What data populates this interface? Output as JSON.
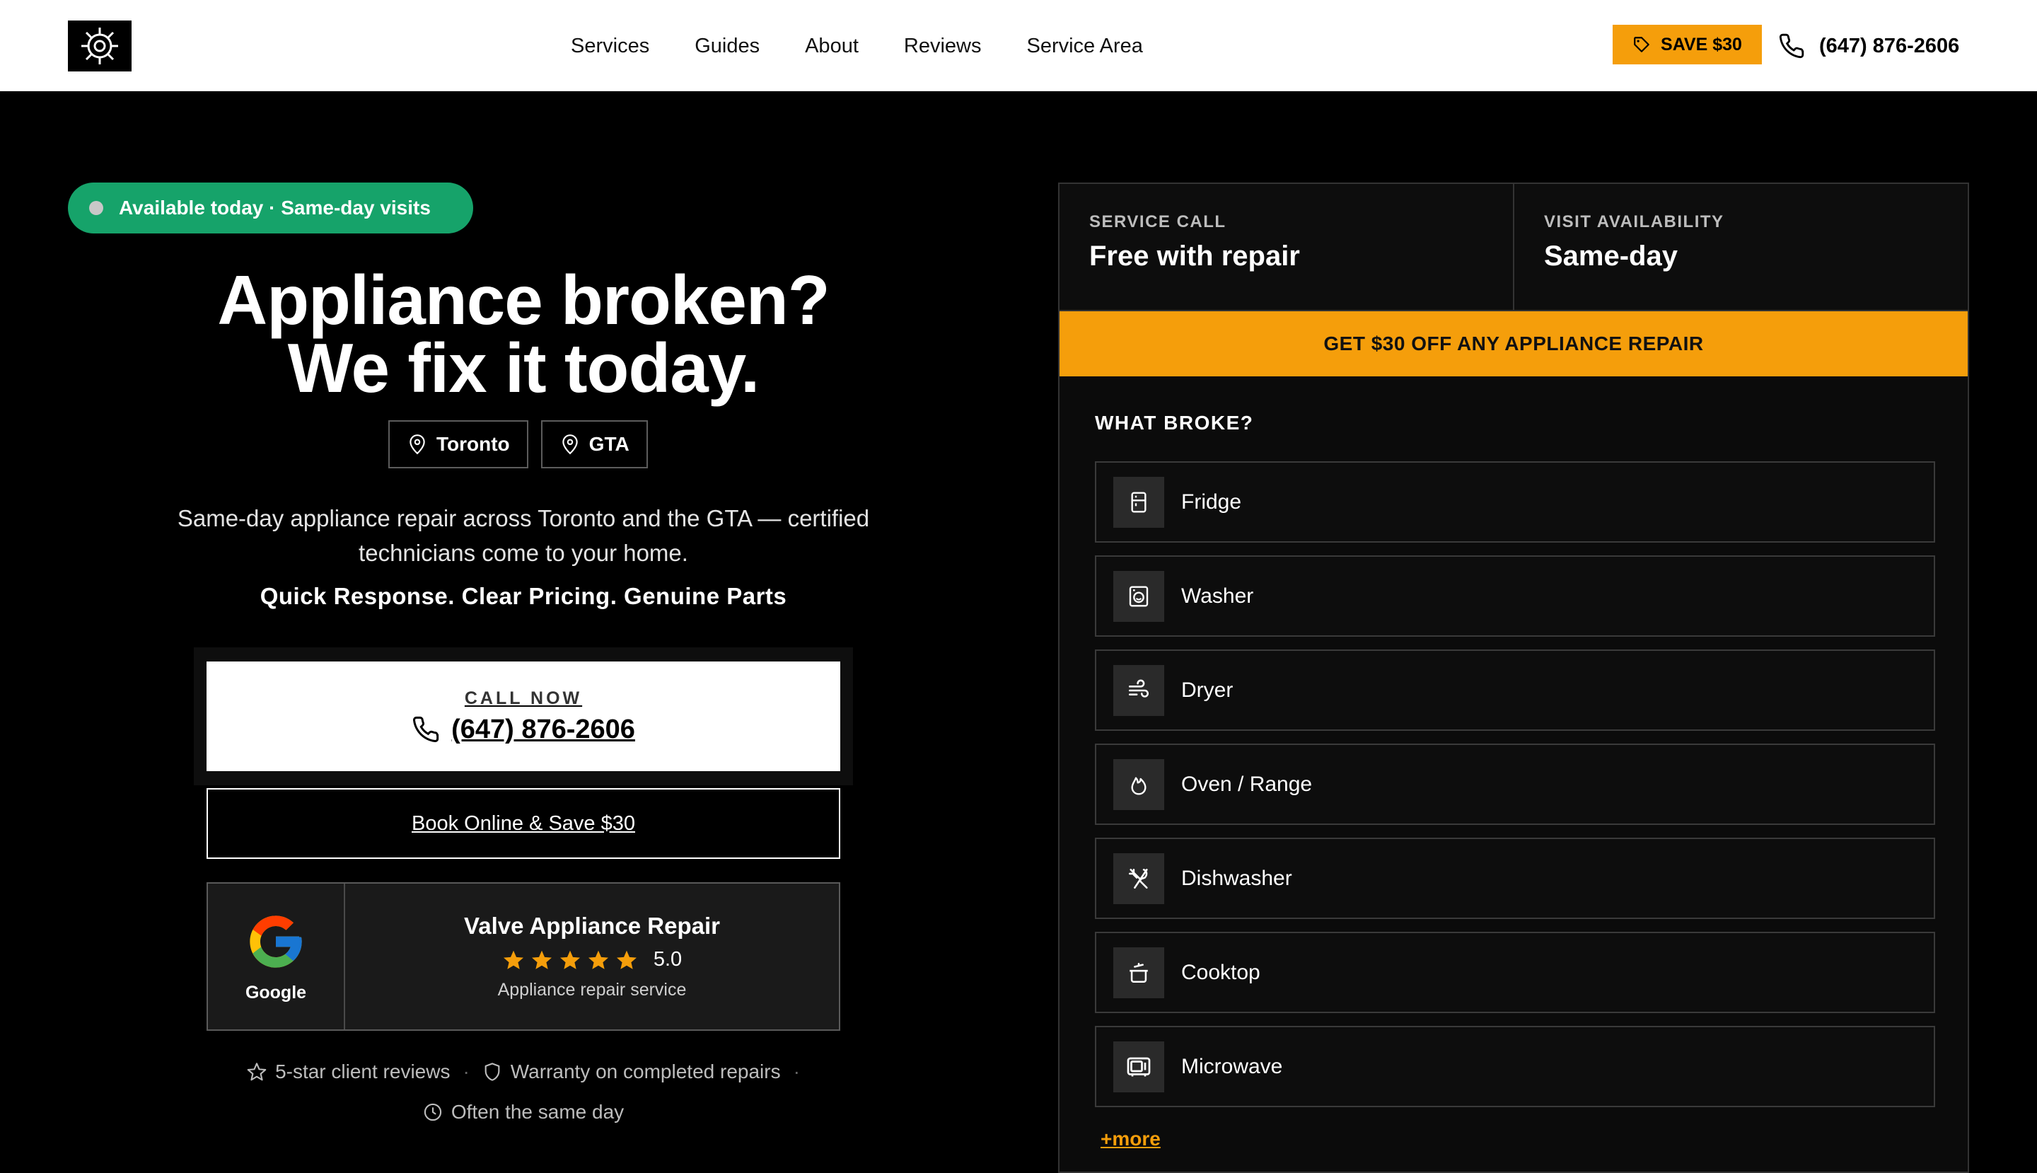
{
  "header": {
    "nav": [
      "Services",
      "Guides",
      "About",
      "Reviews",
      "Service Area"
    ],
    "save_label": "SAVE $30",
    "phone": "(647) 876-2606"
  },
  "hero": {
    "availability": "Available today · Same-day visits",
    "title_line1": "Appliance broken?",
    "title_line2": "We fix it today.",
    "locations": [
      "Toronto",
      "GTA"
    ],
    "subtitle": "Same-day appliance repair across Toronto and the GTA — certified technicians come to your home.",
    "tagline": "Quick Response. Clear Pricing. Genuine Parts",
    "call_label": "CALL NOW",
    "call_number": "(647) 876-2606",
    "book_label": "Book Online & Save $30"
  },
  "review": {
    "provider": "Google",
    "business": "Valve Appliance Repair",
    "rating": "5.0",
    "stars": 5,
    "type": "Appliance repair service"
  },
  "trust": {
    "item1": "5-star client reviews",
    "item2": "Warranty on completed repairs",
    "item3": "Often the same day",
    "separator": "·"
  },
  "panel": {
    "stat1_label": "SERVICE CALL",
    "stat1_value": "Free with repair",
    "stat2_label": "VISIT AVAILABILITY",
    "stat2_value": "Same-day",
    "promo": "GET $30 OFF ANY APPLIANCE REPAIR",
    "what_broke": "WHAT BROKE?",
    "appliances": [
      {
        "label": "Fridge",
        "icon": "fridge-icon"
      },
      {
        "label": "Washer",
        "icon": "washer-icon"
      },
      {
        "label": "Dryer",
        "icon": "dryer-icon"
      },
      {
        "label": "Oven / Range",
        "icon": "flame-icon"
      },
      {
        "label": "Dishwasher",
        "icon": "utensils-icon"
      },
      {
        "label": "Cooktop",
        "icon": "pot-icon"
      },
      {
        "label": "Microwave",
        "icon": "microwave-icon"
      }
    ],
    "more": "+more"
  },
  "colors": {
    "accent": "#f59e0b",
    "green": "#16a36a",
    "background": "#000000"
  }
}
